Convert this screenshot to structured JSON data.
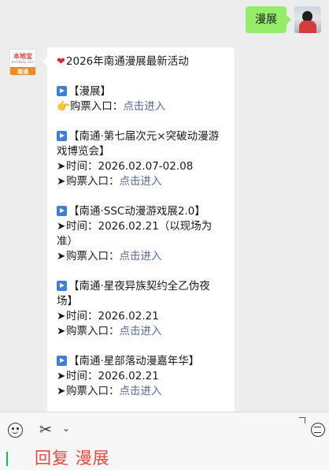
{
  "outgoing": {
    "text": "漫展"
  },
  "incoming": {
    "account_logo": {
      "name": "本地宝",
      "url": "bendibao.com",
      "city": "南通"
    },
    "header": "2026年南通漫展最新活动",
    "section_label": "【漫展】",
    "ticket_label": "购票入口：",
    "link_text": "点击进入",
    "events": [
      {
        "title": "【南通·第七届次元×突破动漫游戏博览会】",
        "time": "时间：2026.02.07-02.08"
      },
      {
        "title": "【南通·SSC动漫游戏展2.0】",
        "time": "时间：2026.02.21（以现场为准）"
      },
      {
        "title": "【南通·星夜异族契约全乙伪夜场】",
        "time": "时间：2026.02.21"
      },
      {
        "title": "【南通·星部落动漫嘉年华】",
        "time": "时间：2026.02.21"
      }
    ]
  },
  "input": {
    "text": "回复 漫展"
  },
  "colors": {
    "out_bubble": "#95ec69",
    "link": "#576b95",
    "hint": "#e8473f",
    "background": "#ededed"
  }
}
